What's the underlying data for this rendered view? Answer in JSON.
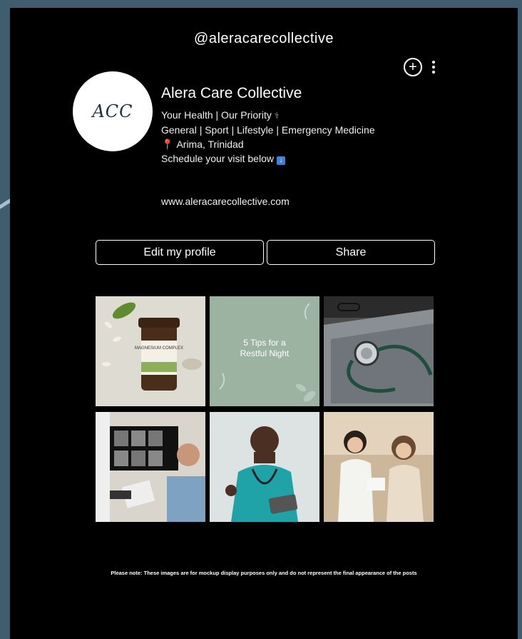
{
  "profile": {
    "handle": "@aleracarecollective",
    "avatar_text": "ACC",
    "name": "Alera Care Collective",
    "bio_lines": [
      "Your Health | Our Priority",
      "General | Sport | Lifestyle |  Emergency Medicine",
      "Arima, Trinidad",
      "Schedule your visit below"
    ],
    "website": "www.aleracarecollective.com"
  },
  "icons": {
    "add": "plus-circle-icon",
    "more": "vertical-dots-icon",
    "pin": "map-pin-icon",
    "arrow": "down-arrow-icon",
    "stethoscope": "stethoscope-icon"
  },
  "actions": {
    "edit_label": "Edit my profile",
    "share_label": "Share"
  },
  "posts": [
    {
      "label": "MAGNESIUM COMPLEX",
      "type": "photo"
    },
    {
      "label": "5 Tips for a Restful Night",
      "type": "text"
    },
    {
      "label": "",
      "type": "photo"
    },
    {
      "label": "",
      "type": "photo"
    },
    {
      "label": "",
      "type": "photo"
    },
    {
      "label": "",
      "type": "photo"
    }
  ],
  "footer_note": "Please note: These images are for mockup display purposes only and do not represent the final appearance of the posts",
  "colors": {
    "background": "#3f5d6f",
    "panel": "#000000",
    "accent_swoosh": "#a8c0cc"
  }
}
